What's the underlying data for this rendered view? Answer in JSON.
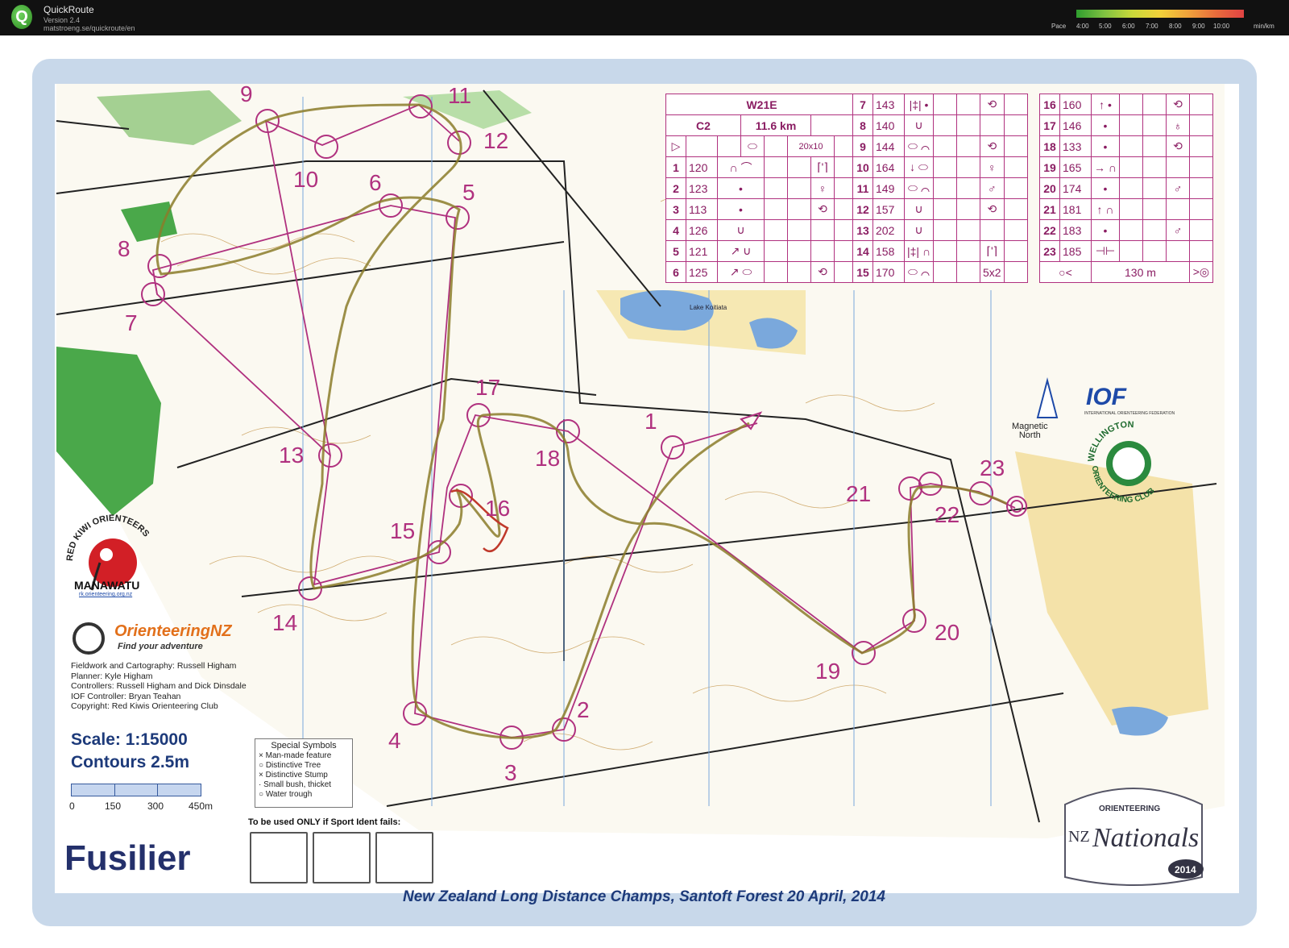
{
  "app": {
    "logo_letter": "Q",
    "name": "QuickRoute",
    "version": "Version 2.4",
    "url": "matstroeng.se/quickroute/en"
  },
  "pace_legend": {
    "label": "Pace",
    "ticks": [
      "4:00",
      "5:00",
      "6:00",
      "7:00",
      "8:00",
      "9:00",
      "10:00"
    ],
    "unit": "min/km",
    "colors": [
      "#2f9e2f",
      "#7fc241",
      "#c9d93a",
      "#f1d13a",
      "#f0a23b",
      "#e96c3c",
      "#e04343"
    ]
  },
  "course": {
    "class": "W21E",
    "course_code": "C2",
    "length": "11.6 km",
    "start_size": "20x10",
    "finish_distance": "130 m",
    "controls": [
      {
        "n": "1",
        "code": "120",
        "sym": "∩ ⌒",
        "desc": "⌈'⌉"
      },
      {
        "n": "2",
        "code": "123",
        "sym": "•",
        "desc": "♀"
      },
      {
        "n": "3",
        "code": "113",
        "sym": "•",
        "desc": "⟲"
      },
      {
        "n": "4",
        "code": "126",
        "sym": "∪",
        "desc": ""
      },
      {
        "n": "5",
        "code": "121",
        "sym": "↗ ∪",
        "desc": ""
      },
      {
        "n": "6",
        "code": "125",
        "sym": "↗ ⬭",
        "desc": "⟲"
      },
      {
        "n": "7",
        "code": "143",
        "sym": "|‡| •",
        "desc": "⟲"
      },
      {
        "n": "8",
        "code": "140",
        "sym": "∪",
        "desc": ""
      },
      {
        "n": "9",
        "code": "144",
        "sym": "⬭ ⌒",
        "desc": "⟲"
      },
      {
        "n": "10",
        "code": "164",
        "sym": "↓ ⬭",
        "desc": "♀"
      },
      {
        "n": "11",
        "code": "149",
        "sym": "⬭ ⌒",
        "desc": "♂"
      },
      {
        "n": "12",
        "code": "157",
        "sym": "∪",
        "desc": "⟲"
      },
      {
        "n": "13",
        "code": "202",
        "sym": "∪",
        "desc": ""
      },
      {
        "n": "14",
        "code": "158",
        "sym": "|‡| ∩",
        "desc": "⌈'⌉"
      },
      {
        "n": "15",
        "code": "170",
        "sym": "⬭ ⌒",
        "desc": "5x2"
      },
      {
        "n": "16",
        "code": "160",
        "sym": "↑ •",
        "desc": "⟲"
      },
      {
        "n": "17",
        "code": "146",
        "sym": "•",
        "desc": "♁"
      },
      {
        "n": "18",
        "code": "133",
        "sym": "•",
        "desc": "⟲"
      },
      {
        "n": "19",
        "code": "165",
        "sym": "→ ∩",
        "desc": ""
      },
      {
        "n": "20",
        "code": "174",
        "sym": "•",
        "desc": "♂"
      },
      {
        "n": "21",
        "code": "181",
        "sym": "↑ ∩",
        "desc": ""
      },
      {
        "n": "22",
        "code": "183",
        "sym": "•",
        "desc": "♂"
      },
      {
        "n": "23",
        "code": "185",
        "sym": "⊣⊢",
        "desc": ""
      }
    ]
  },
  "map_labels": {
    "control_numbers": [
      "1",
      "2",
      "3",
      "4",
      "5",
      "6",
      "7",
      "8",
      "9",
      "10",
      "11",
      "12",
      "13",
      "14",
      "15",
      "16",
      "17",
      "18",
      "19",
      "20",
      "21",
      "22",
      "23"
    ],
    "lake": "Lake Koitiata",
    "magnetic_north": [
      "Magnetic",
      "North"
    ]
  },
  "logos": {
    "red_kiwi": {
      "arc_text": "RED KIWI ORIENTEERS",
      "bottom": "MANAWATU",
      "url": "rk.orienteering.org.nz"
    },
    "orienteering_nz": {
      "name": "OrienteeringNZ",
      "tagline": "Find your adventure"
    },
    "iof": {
      "name": "IOF",
      "sub": "INTERNATIONAL ORIENTEERING FEDERATION"
    },
    "wellington": {
      "top": "WELLINGTON",
      "bottom": "ORIENTEERING CLUB"
    },
    "nationals": {
      "top": "ORIENTEERING",
      "nz": "NZ",
      "main": "Nationals",
      "year": "2014"
    }
  },
  "credits": [
    "Fieldwork and Cartography: Russell Higham",
    "Planner: Kyle Higham",
    "Controllers: Russell Higham and Dick Dinsdale",
    "IOF Controller: Bryan Teahan",
    "Copyright: Red Kiwis Orienteering Club"
  ],
  "scale": {
    "scale_text": "Scale: 1:15000",
    "contours_text": "Contours  2.5m",
    "labels": [
      "0",
      "150",
      "300",
      "450m"
    ]
  },
  "special_symbols": {
    "heading": "Special Symbols",
    "items": [
      "× Man-made feature",
      "○ Distinctive Tree",
      "× Distinctive Stump",
      "· Small bush, thicket",
      "○ Water trough"
    ]
  },
  "sport_ident_note": "To be used ONLY if Sport Ident fails:",
  "map_name": "Fusilier",
  "footer": "New Zealand Long Distance Champs, Santoft Forest    20 April, 2014",
  "colors": {
    "course_magenta": "#b0317f",
    "route": "#8b7d2a",
    "forest_green": "#4aa84a",
    "water_blue": "#7aa8dc",
    "sheet_border": "#c8d8ea",
    "title_blue": "#1d3a7a"
  }
}
